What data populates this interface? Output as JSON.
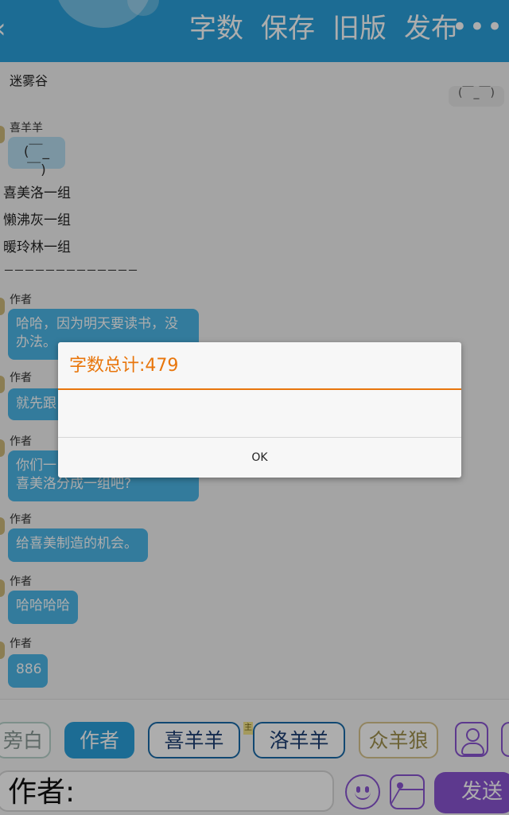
{
  "topbar": {
    "actions": [
      "字数",
      "保存",
      "旧版",
      "发布"
    ],
    "back_icon": "chevron-left-icon",
    "more_icon": "more-icon"
  },
  "chat": {
    "header_line": "迷雾谷",
    "name_xiyangyang": "喜羊羊",
    "emoticon": "(￣_￣)",
    "right_emoticon": "(￣_￣)",
    "lines": [
      "喜美洛一组",
      "懒沸灰一组",
      "暖玲林一组",
      "－－－－－－－－－－－－－"
    ],
    "messages": [
      {
        "name": "作者",
        "text": "哈哈，因为明天要读书，没办法。"
      },
      {
        "name": "作者",
        "text": "就先跟"
      },
      {
        "name": "作者",
        "text": "你们一",
        "text2": "喜美洛分成一组吧?"
      },
      {
        "name": "作者",
        "text": "给喜美制造的机会。"
      },
      {
        "name": "作者",
        "text": "哈哈哈哈"
      },
      {
        "name": "作者",
        "text": "886"
      }
    ]
  },
  "roles": [
    "旁白",
    "作者",
    "喜羊羊",
    "洛羊羊",
    "众羊狼"
  ],
  "role_badge": "主",
  "input": {
    "value": "作者:",
    "send_label": "发送"
  },
  "dialog": {
    "title": "字数总计:479",
    "ok_label": "OK"
  },
  "colors": {
    "topbar": "#2aa0da",
    "accent_orange": "#e8760c",
    "purple": "#8a55d2",
    "bubble": "#4cb5e6"
  }
}
